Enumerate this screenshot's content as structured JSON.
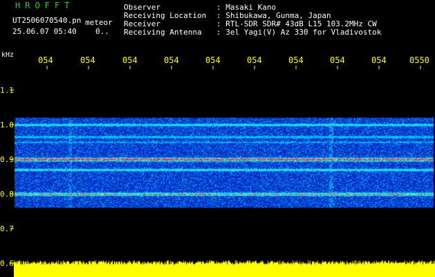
{
  "header": {
    "brand": "HROFFT",
    "filename": "UT2506070540.pn",
    "mode": "meteor",
    "datetime": "25.06.07 05:40",
    "counter": "0.."
  },
  "station": [
    {
      "label": "Observer",
      "value": ": Masaki Kano"
    },
    {
      "label": "Receiving Location",
      "value": ": Shibukawa, Gunma, Japan"
    },
    {
      "label": "Receiver",
      "value": ": RTL-SDR SDR# 43dB L15 103.2MHz CW"
    },
    {
      "label": "Receiving Antenna",
      "value": ": 3el Yagi(V) Az 330 for Vladivostok"
    }
  ],
  "axis": {
    "unit": "kHz",
    "y_ticks": [
      "1.1",
      "1.0",
      "0.9",
      "0.8",
      "0.7",
      "0.6"
    ],
    "x_ticks": [
      "054",
      "054",
      "054",
      "054",
      "054",
      "054",
      "054",
      "054",
      "054",
      "0550"
    ]
  },
  "colors": {
    "background": "#000000",
    "text": "#ffffff",
    "brand": "#33cc33",
    "axis": "#ffff00",
    "signal_low": "#0a1a9a",
    "signal_mid": "#00c8ff",
    "signal_high": "#ff2040",
    "level_bar": "#ffff00"
  },
  "spectrogram": {
    "freq_range_khz": [
      0.6,
      1.15
    ],
    "carriers_khz": [
      1.0,
      0.965,
      0.9,
      0.87,
      0.8
    ]
  }
}
